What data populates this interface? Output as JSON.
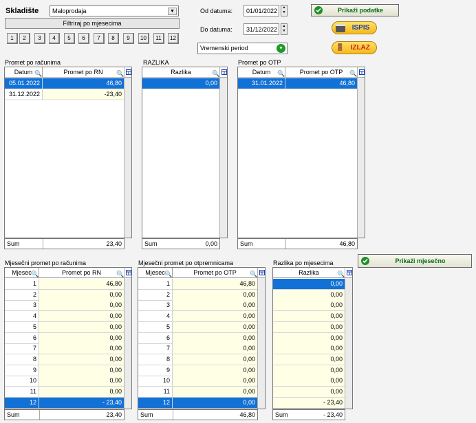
{
  "header": {
    "warehouse_label": "Skladište",
    "warehouse_value": "Maloprodaja",
    "filter_button": "Filtriraj po mjesecima",
    "months": [
      "1",
      "2",
      "3",
      "4",
      "5",
      "6",
      "7",
      "8",
      "9",
      "10",
      "11",
      "12"
    ],
    "from_label": "Od datuma:",
    "from_value": "01/01/2022",
    "to_label": "Do datuma:",
    "to_value": "31/12/2022",
    "period_value": "Vremenski period",
    "show_data": "Prikaži podatke",
    "print": "ISPIS",
    "exit": "IZLAZ",
    "show_monthly": "Prikaži mjesečno"
  },
  "promet_rn": {
    "title": "Promet po računima",
    "col1": "Datum",
    "col2": "Promet po RN",
    "rows": [
      [
        "05.01.2022",
        "46,80"
      ],
      [
        "31.12.2022",
        "-23,40"
      ]
    ],
    "sum_label": "Sum",
    "sum_value": "23,40"
  },
  "razlika": {
    "title": "RAZLIKA",
    "col1": "Razlika",
    "rows": [
      [
        "0,00"
      ]
    ],
    "sum_label": "Sum",
    "sum_value": "0,00"
  },
  "promet_otp": {
    "title": "Promet po OTP",
    "col1": "Datum",
    "col2": "Promet po OTP",
    "rows": [
      [
        "31.01.2022",
        "46,80"
      ]
    ],
    "sum_label": "Sum",
    "sum_value": "46,80"
  },
  "mj_rn": {
    "title": "Mjesečni promet po računima",
    "col1": "Mjesec",
    "col2": "Promet po RN",
    "rows": [
      [
        "1",
        "46,80"
      ],
      [
        "2",
        "0,00"
      ],
      [
        "3",
        "0,00"
      ],
      [
        "4",
        "0,00"
      ],
      [
        "5",
        "0,00"
      ],
      [
        "6",
        "0,00"
      ],
      [
        "7",
        "0,00"
      ],
      [
        "8",
        "0,00"
      ],
      [
        "9",
        "0,00"
      ],
      [
        "10",
        "0,00"
      ],
      [
        "11",
        "0,00"
      ],
      [
        "12",
        "- 23,40"
      ]
    ],
    "sum_label": "Sum",
    "sum_value": "23,40"
  },
  "mj_otp": {
    "title": "Mjesečni promet po otpremnicama",
    "col1": "Mjesec",
    "col2": "Promet po OTP",
    "rows": [
      [
        "1",
        "46,80"
      ],
      [
        "2",
        "0,00"
      ],
      [
        "3",
        "0,00"
      ],
      [
        "4",
        "0,00"
      ],
      [
        "5",
        "0,00"
      ],
      [
        "6",
        "0,00"
      ],
      [
        "7",
        "0,00"
      ],
      [
        "8",
        "0,00"
      ],
      [
        "9",
        "0,00"
      ],
      [
        "10",
        "0,00"
      ],
      [
        "11",
        "0,00"
      ],
      [
        "12",
        "0,00"
      ]
    ],
    "sum_label": "Sum",
    "sum_value": "46,80"
  },
  "mj_razlika": {
    "title": "Razlika po mjesecima",
    "col1": "Razlika",
    "rows": [
      [
        "0,00"
      ],
      [
        "0,00"
      ],
      [
        "0,00"
      ],
      [
        "0,00"
      ],
      [
        "0,00"
      ],
      [
        "0,00"
      ],
      [
        "0,00"
      ],
      [
        "0,00"
      ],
      [
        "0,00"
      ],
      [
        "0,00"
      ],
      [
        "0,00"
      ],
      [
        "- 23,40"
      ]
    ],
    "sum_label": "Sum",
    "sum_value": "- 23,40"
  }
}
